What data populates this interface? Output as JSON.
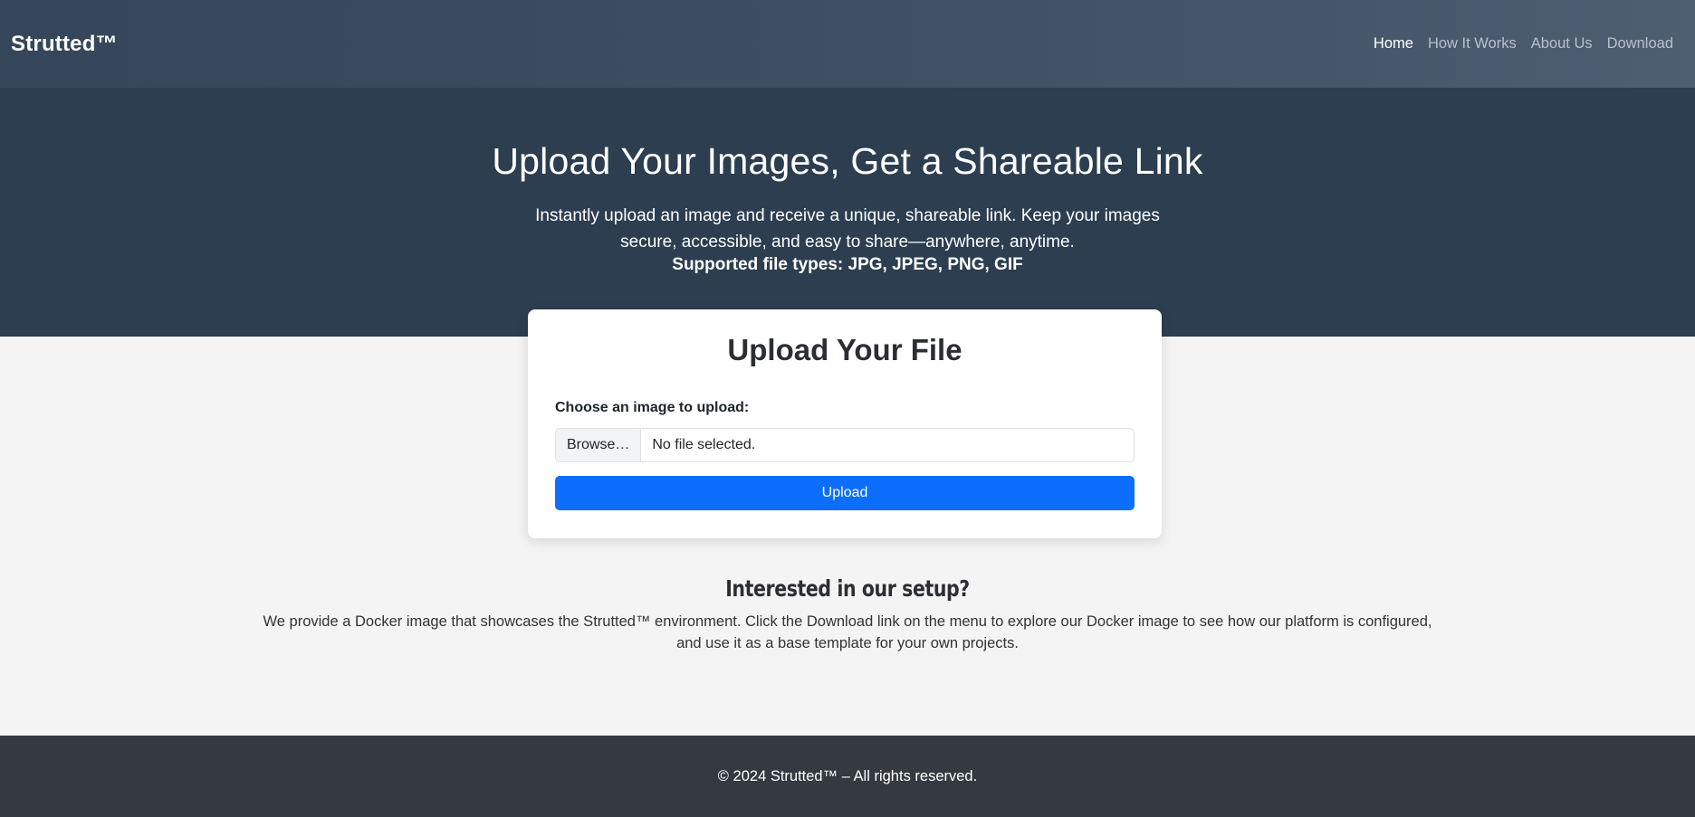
{
  "navbar": {
    "brand": "Strutted™",
    "links": [
      {
        "label": "Home",
        "active": true
      },
      {
        "label": "How It Works",
        "active": false
      },
      {
        "label": "About Us",
        "active": false
      },
      {
        "label": "Download",
        "active": false
      }
    ]
  },
  "hero": {
    "title": "Upload Your Images, Get a Shareable Link",
    "description": "Instantly upload an image and receive a unique, shareable link. Keep your images secure, accessible, and easy to share—anywhere, anytime.",
    "supported_types": "Supported file types: JPG, JPEG, PNG, GIF"
  },
  "upload_card": {
    "title": "Upload Your File",
    "field_label": "Choose an image to upload:",
    "browse_label": "Browse…",
    "file_status": "No file selected.",
    "upload_label": "Upload"
  },
  "setup": {
    "title": "Interested in our setup?",
    "text": "We provide a Docker image that showcases the Strutted™ environment. Click the Download link on the menu to explore our Docker image to see how our platform is configured, and use it as a base template for your own projects."
  },
  "footer": {
    "text": "© 2024 Strutted™ – All rights reserved."
  },
  "colors": {
    "hero_bg": "#2c3e50",
    "primary": "#0d6efd",
    "footer_bg": "#343a40",
    "page_bg": "#f4f4f4"
  }
}
